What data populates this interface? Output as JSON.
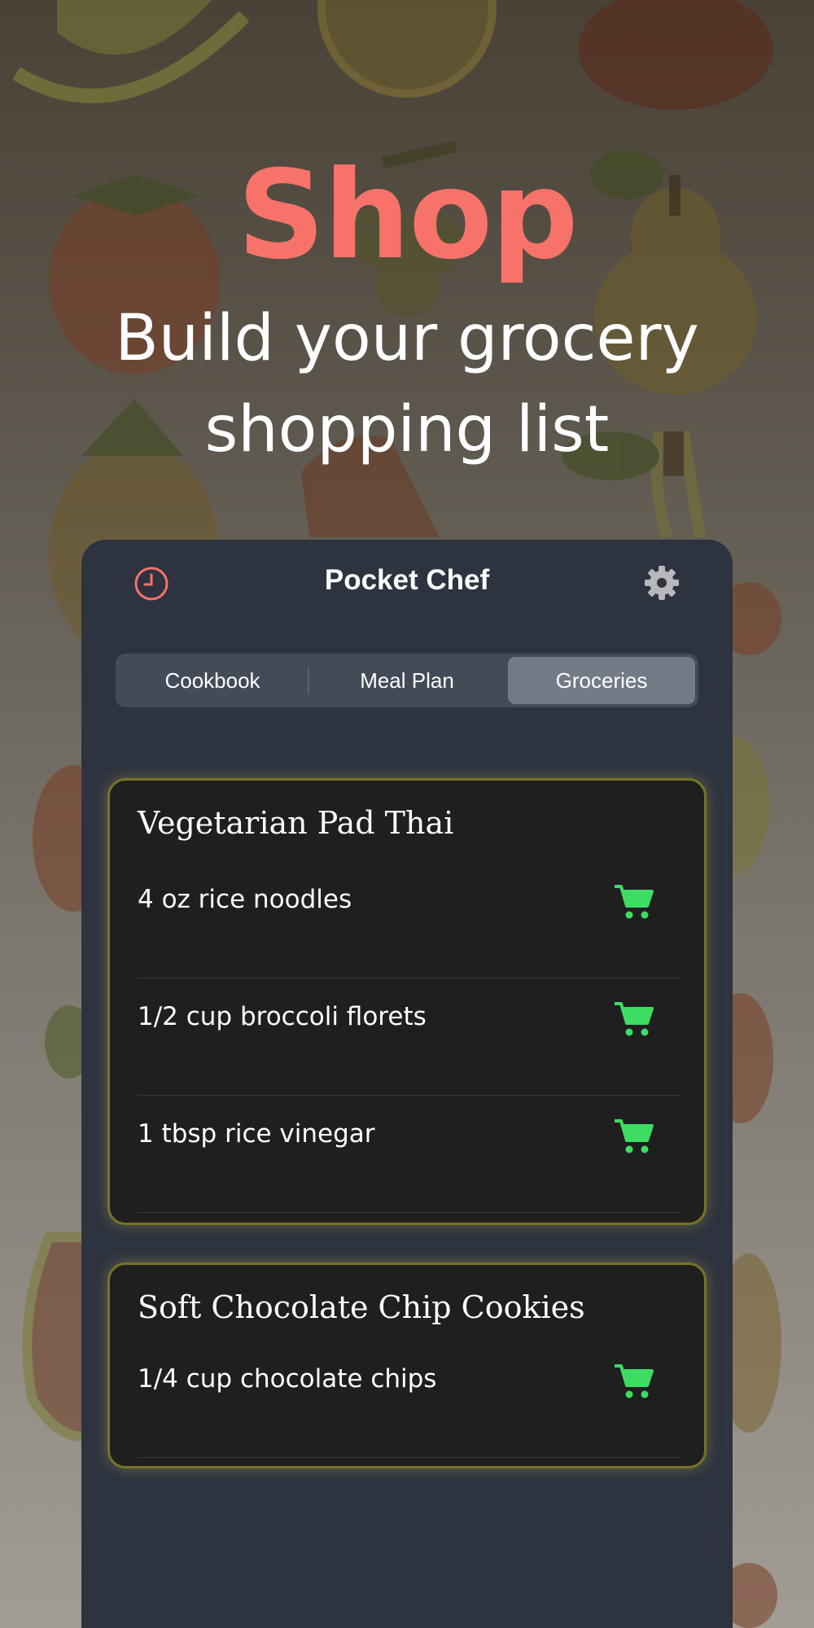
{
  "hero": {
    "title": "Shop",
    "subtitle_line1": "Build your grocery",
    "subtitle_line2": "shopping list"
  },
  "app": {
    "title": "Pocket Chef",
    "left_icon": "clock-icon",
    "right_icon": "gear-icon"
  },
  "tabs": [
    {
      "label": "Cookbook",
      "active": false
    },
    {
      "label": "Meal Plan",
      "active": false
    },
    {
      "label": "Groceries",
      "active": true
    }
  ],
  "recipes": [
    {
      "title": "Vegetarian Pad Thai",
      "items": [
        "4 oz rice noodles",
        "1/2 cup broccoli florets",
        "1 tbsp rice vinegar"
      ]
    },
    {
      "title": "Soft Chocolate Chip Cookies",
      "items": [
        "1/4 cup chocolate chips"
      ]
    }
  ],
  "colors": {
    "accent": "#f7736a",
    "cart": "#3ddc63",
    "card_border": "#7a7227",
    "panel": "#2d333f"
  }
}
